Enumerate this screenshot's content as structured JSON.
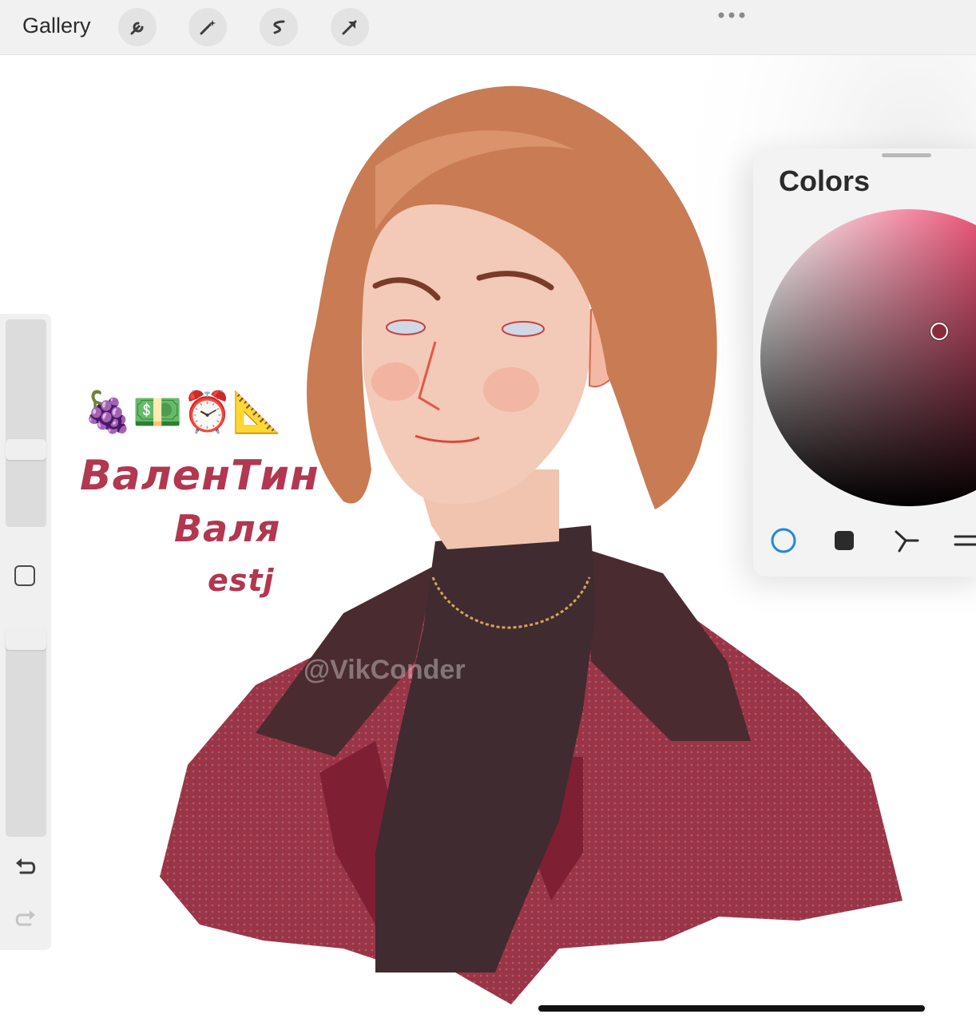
{
  "toolbar": {
    "gallery_label": "Gallery",
    "tools": [
      {
        "name": "wrench-icon"
      },
      {
        "name": "magic-wand-icon"
      },
      {
        "name": "selection-icon"
      },
      {
        "name": "transform-arrow-icon"
      }
    ],
    "more_icon": "ellipsis-icon"
  },
  "sidebar": {
    "undo_icon": "undo-icon",
    "redo_icon": "redo-icon",
    "modify_icon": "square-modify-icon"
  },
  "artwork": {
    "emojis": "🍇💵⏰📐",
    "name_line1": "ВаленТин",
    "name_line2": "Валя",
    "name_line3": "estj",
    "watermark": "@VikConder"
  },
  "colors_panel": {
    "title": "Colors",
    "modes": [
      "disc-mode-icon",
      "classic-mode-icon",
      "harmony-mode-icon",
      "value-mode-icon"
    ],
    "accent": "#1e88e5",
    "selected_color": "#8a2b3c"
  }
}
